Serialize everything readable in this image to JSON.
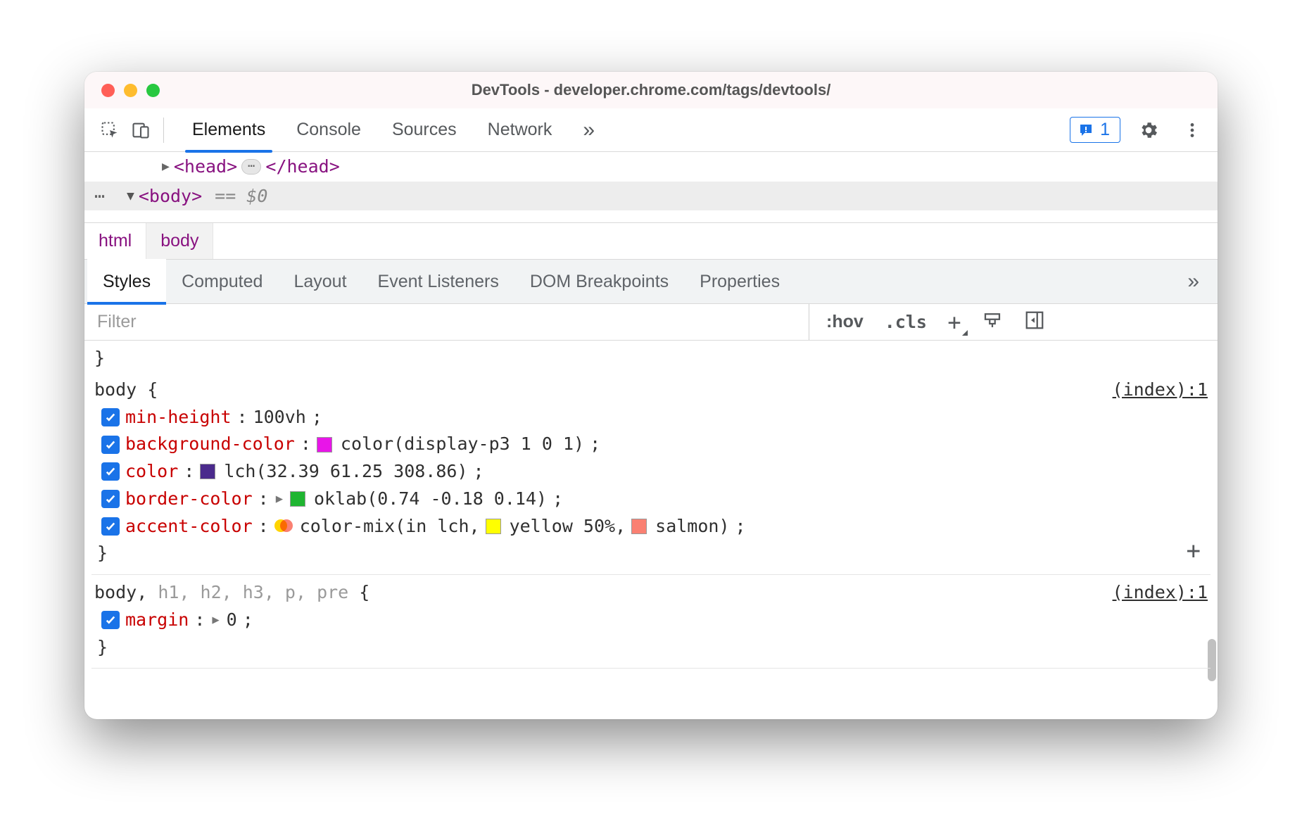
{
  "window": {
    "title": "DevTools - developer.chrome.com/tags/devtools/"
  },
  "main_tabs": [
    "Elements",
    "Console",
    "Sources",
    "Network"
  ],
  "main_tabs_active": 0,
  "issues_count": "1",
  "dom": {
    "line1_open": "<head>",
    "line1_close": "</head>",
    "line2_open": "<body>",
    "eq0": "== $0",
    "ellipsis": "⋯"
  },
  "breadcrumb": [
    "html",
    "body"
  ],
  "sub_tabs": [
    "Styles",
    "Computed",
    "Layout",
    "Event Listeners",
    "DOM Breakpoints",
    "Properties"
  ],
  "sub_tabs_active": 0,
  "filter": {
    "placeholder": "Filter",
    "hov": ":hov",
    "cls": ".cls"
  },
  "rules": [
    {
      "selector_html": "body {",
      "source": "(index):1",
      "props": [
        {
          "name": "min-height",
          "value_parts": [
            {
              "text": "100vh"
            }
          ]
        },
        {
          "name": "background-color",
          "value_parts": [
            {
              "swatch": "#e815e8"
            },
            {
              "text": "color(display-p3 1 0 1)"
            }
          ]
        },
        {
          "name": "color",
          "value_parts": [
            {
              "swatch": "#4a2a8c"
            },
            {
              "text": "lch(32.39 61.25 308.86)"
            }
          ]
        },
        {
          "name": "border-color",
          "expand": true,
          "value_parts": [
            {
              "swatch": "#1fb531"
            },
            {
              "text": "oklab(0.74 -0.18 0.14)"
            }
          ]
        },
        {
          "name": "accent-color",
          "value_parts": [
            {
              "mix": true
            },
            {
              "text": "color-mix(in lch, "
            },
            {
              "swatch": "#ffff00"
            },
            {
              "text": "yellow 50%, "
            },
            {
              "swatch": "#fa8072"
            },
            {
              "text": "salmon)"
            }
          ]
        }
      ],
      "close": "}"
    },
    {
      "selector_html": "body, <dim>h1, h2, h3, p, pre</dim> {",
      "source": "(index):1",
      "props": [
        {
          "name": "margin",
          "expand": true,
          "value_parts": [
            {
              "text": "0"
            }
          ]
        }
      ],
      "close": "}"
    }
  ],
  "icons": {
    "more": "»",
    "plus": "+",
    "times": "×"
  }
}
